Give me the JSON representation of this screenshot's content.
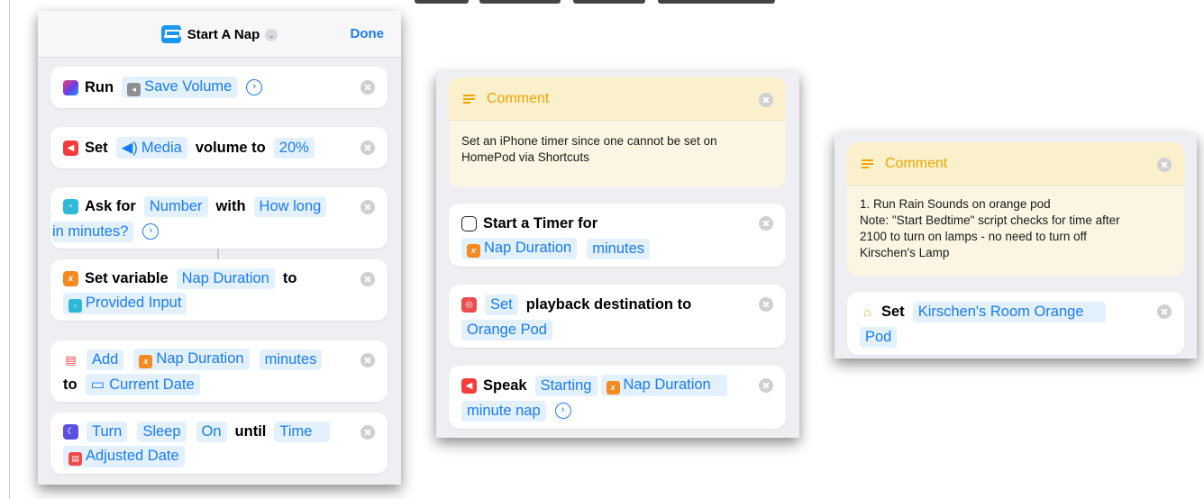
{
  "panel1": {
    "header": {
      "title": "Start A Nap",
      "done_label": "Done"
    },
    "actions": {
      "run": {
        "verb": "Run",
        "shortcut": "Save Volume"
      },
      "set_volume": {
        "verb": "Set",
        "target": "Media",
        "middle": "volume to",
        "value": "20%"
      },
      "ask": {
        "verb": "Ask for",
        "type": "Number",
        "with": "with",
        "prompt_1": "How long",
        "prompt_2": "in minutes?"
      },
      "set_variable": {
        "verb": "Set variable",
        "name": "Nap Duration",
        "to": "to",
        "value": "Provided Input"
      },
      "add": {
        "verb": "Add",
        "variable": "Nap Duration",
        "unit": "minutes",
        "to": "to",
        "date": "Current Date"
      },
      "turn": {
        "verb": "Turn",
        "mode": "Sleep",
        "state": "On",
        "until": "until",
        "time": "Time",
        "date": "Adjusted Date"
      }
    }
  },
  "panel2": {
    "comment": {
      "title": "Comment",
      "text": "Set an iPhone timer since one cannot be set on\nHomePod via Shortcuts"
    },
    "timer": {
      "verb": "Start a Timer for",
      "variable": "Nap Duration",
      "unit": "minutes"
    },
    "playback": {
      "verb": "Set",
      "middle": "playback destination to",
      "device": "Orange Pod"
    },
    "speak": {
      "verb": "Speak",
      "text": "Starting",
      "variable": "Nap Duration",
      "suffix": "minute nap"
    }
  },
  "panel3": {
    "comment": {
      "title": "Comment",
      "text": "1. Run Rain Sounds on orange pod\nNote: \"Start Bedtime\" script checks for time after\n2100 to turn on lamps - no need to turn off\nKirschen's Lamp"
    },
    "set_scene": {
      "verb": "Set",
      "scene_1": "Kirschen's Room Orange",
      "scene_2": "Pod"
    }
  }
}
